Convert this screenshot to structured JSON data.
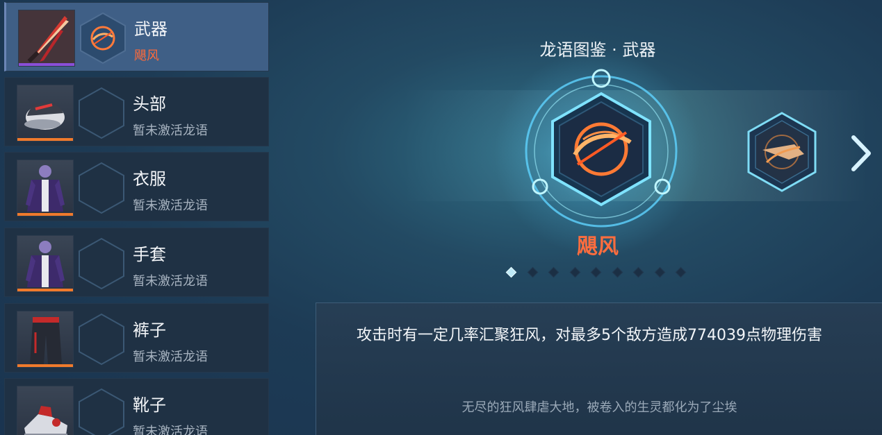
{
  "slots": [
    {
      "title": "武器",
      "status": "飓风",
      "icon": "sword-icon",
      "active": true
    },
    {
      "title": "头部",
      "status": "暂未激活龙语",
      "icon": "cap-icon",
      "active": false
    },
    {
      "title": "衣服",
      "status": "暂未激活龙语",
      "icon": "jacket-icon",
      "active": false
    },
    {
      "title": "手套",
      "status": "暂未激活龙语",
      "icon": "glove-icon",
      "active": false
    },
    {
      "title": "裤子",
      "status": "暂未激活龙语",
      "icon": "pants-icon",
      "active": false
    },
    {
      "title": "靴子",
      "status": "暂未激活龙语",
      "icon": "boots-icon",
      "active": false
    }
  ],
  "codex": {
    "title": "龙语图鉴 · 武器",
    "selected_name": "飓风",
    "page_count": 9,
    "current_page": 1
  },
  "description": {
    "effect": "攻击时有一定几率汇聚狂风，对最多5个敌方造成774039点物理伤害",
    "flavor": "无尽的狂风肆虐大地，被卷入的生灵都化为了尘埃"
  },
  "colors": {
    "accent_orange": "#ff6d3e",
    "rarity_orange": "#f07a2c",
    "rarity_purple": "#8a4fd8",
    "glow_cyan": "#7fe3ff"
  }
}
